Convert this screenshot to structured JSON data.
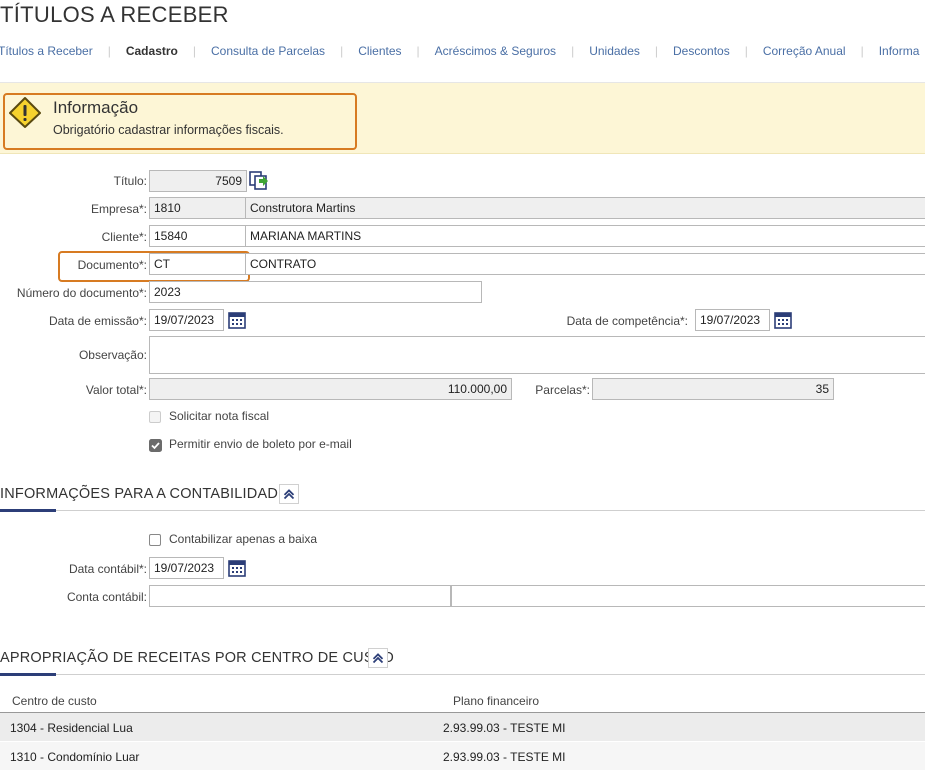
{
  "page": {
    "title": "TÍTULOS A RECEBER"
  },
  "tabs": [
    {
      "label": "Títulos a Receber"
    },
    {
      "label": "Cadastro"
    },
    {
      "label": "Consulta de Parcelas"
    },
    {
      "label": "Clientes"
    },
    {
      "label": "Acréscimos & Seguros"
    },
    {
      "label": "Unidades"
    },
    {
      "label": "Descontos"
    },
    {
      "label": "Correção Anual"
    },
    {
      "label": "Informa"
    }
  ],
  "info": {
    "title": "Informação",
    "message": "Obrigatório cadastrar informações fiscais.",
    "icon": "warning-icon"
  },
  "form": {
    "titulo": {
      "label": "Título:",
      "value": "7509"
    },
    "empresa": {
      "label": "Empresa*:",
      "code": "1810",
      "name": "Construtora Martins"
    },
    "cliente": {
      "label": "Cliente*:",
      "code": "15840",
      "name": "MARIANA MARTINS"
    },
    "documento": {
      "label": "Documento*:",
      "code": "CT",
      "name": "CONTRATO"
    },
    "numero_documento": {
      "label": "Número do documento*:",
      "value": "2023"
    },
    "data_emissao": {
      "label": "Data de emissão*:",
      "value": "19/07/2023"
    },
    "data_competencia": {
      "label": "Data de competência*:",
      "value": "19/07/2023"
    },
    "observacao": {
      "label": "Observação:",
      "value": ""
    },
    "valor_total": {
      "label": "Valor total*:",
      "value": "110.000,00"
    },
    "parcelas": {
      "label": "Parcelas*:",
      "value": "35"
    },
    "solicitar_nf": {
      "label": "Solicitar nota fiscal",
      "checked": false,
      "disabled": true
    },
    "envio_boleto": {
      "label": "Permitir envio de boleto por e-mail",
      "checked": true
    }
  },
  "contabilidade": {
    "title": "INFORMAÇÕES PARA A CONTABILIDADE",
    "apenas_baixa": {
      "label": "Contabilizar apenas a baixa",
      "checked": false
    },
    "data_contabil": {
      "label": "Data contábil*:",
      "value": "19/07/2023"
    },
    "conta_contabil": {
      "label": "Conta contábil:",
      "code": "",
      "name": ""
    }
  },
  "apropriacao": {
    "title": "APROPRIAÇÃO DE RECEITAS POR CENTRO DE CUSTO",
    "columns": [
      "Centro de custo",
      "Plano financeiro"
    ],
    "rows": [
      [
        "1304 - Residencial Lua",
        "2.93.99.03 - TESTE MI"
      ],
      [
        "1310 - Condomínio Luar",
        "2.93.99.03 - TESTE MI"
      ]
    ]
  },
  "colors": {
    "accent": "#d77b22",
    "link": "#4a6fa5",
    "section_accent": "#2c3e78",
    "info_bg": "#fdf6d6"
  }
}
